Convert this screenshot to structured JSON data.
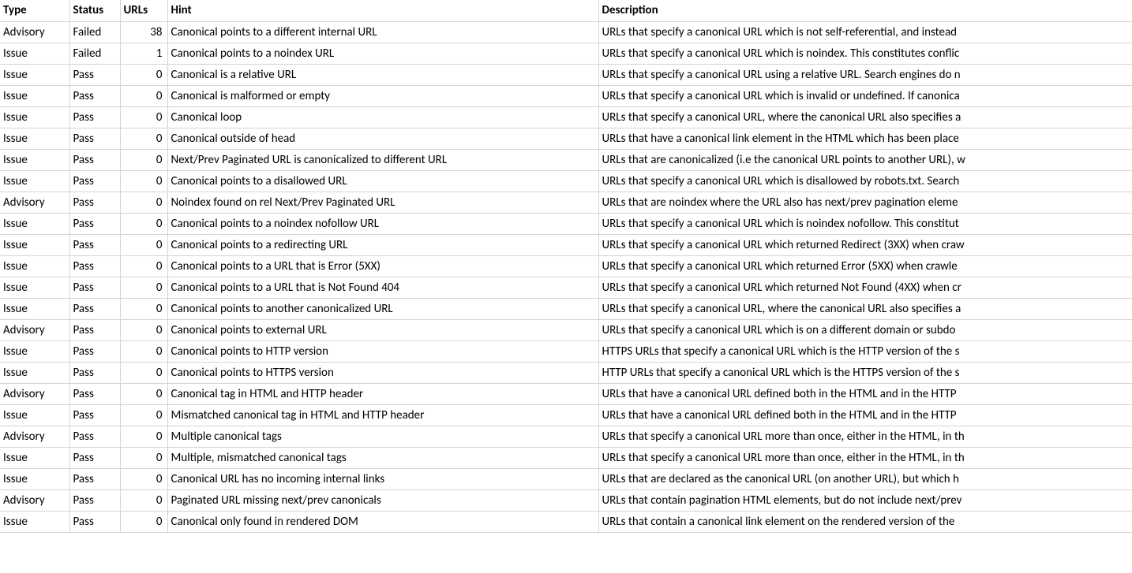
{
  "headers": {
    "type": "Type",
    "status": "Status",
    "urls": "URLs",
    "hint": "Hint",
    "description": "Description"
  },
  "rows": [
    {
      "type": "Advisory",
      "status": "Failed",
      "urls": 38,
      "hint": "Canonical points to a different internal URL",
      "description": "URLs that specify a canonical URL which is not self-referential, and instead"
    },
    {
      "type": "Issue",
      "status": "Failed",
      "urls": 1,
      "hint": "Canonical points to a noindex URL",
      "description": "URLs that specify a canonical URL which is noindex. This constitutes conflic"
    },
    {
      "type": "Issue",
      "status": "Pass",
      "urls": 0,
      "hint": "Canonical is a relative URL",
      "description": "URLs that specify a canonical URL using a relative URL. Search engines do n"
    },
    {
      "type": "Issue",
      "status": "Pass",
      "urls": 0,
      "hint": "Canonical is malformed or empty",
      "description": "URLs that specify a canonical URL which is invalid or undefined. If canonica"
    },
    {
      "type": "Issue",
      "status": "Pass",
      "urls": 0,
      "hint": "Canonical loop",
      "description": "URLs that specify a canonical URL, where the canonical URL also specifies a"
    },
    {
      "type": "Issue",
      "status": "Pass",
      "urls": 0,
      "hint": "Canonical outside of head",
      "description": "URLs that have a canonical link element in the HTML which has been place"
    },
    {
      "type": "Issue",
      "status": "Pass",
      "urls": 0,
      "hint": "Next/Prev Paginated URL is canonicalized to different URL",
      "description": "URLs that are canonicalized (i.e the canonical URL points to another URL), w"
    },
    {
      "type": "Issue",
      "status": "Pass",
      "urls": 0,
      "hint": "Canonical points to a disallowed URL",
      "description": "URLs that specify a canonical URL which is disallowed by robots.txt. Search"
    },
    {
      "type": "Advisory",
      "status": "Pass",
      "urls": 0,
      "hint": "Noindex found on rel Next/Prev Paginated URL",
      "description": "URLs that are noindex where the URL also has next/prev pagination eleme"
    },
    {
      "type": "Issue",
      "status": "Pass",
      "urls": 0,
      "hint": "Canonical points to a noindex nofollow URL",
      "description": "URLs that specify a canonical URL which is noindex nofollow. This constitut"
    },
    {
      "type": "Issue",
      "status": "Pass",
      "urls": 0,
      "hint": "Canonical points to a redirecting URL",
      "description": "URLs that specify a canonical URL which returned Redirect (3XX) when craw"
    },
    {
      "type": "Issue",
      "status": "Pass",
      "urls": 0,
      "hint": "Canonical points to a URL that is Error (5XX)",
      "description": "URLs that specify a canonical URL which returned Error (5XX) when crawle"
    },
    {
      "type": "Issue",
      "status": "Pass",
      "urls": 0,
      "hint": "Canonical points to a URL that is Not Found 404",
      "description": "URLs that specify a canonical URL which returned Not Found (4XX) when cr"
    },
    {
      "type": "Issue",
      "status": "Pass",
      "urls": 0,
      "hint": "Canonical points to another canonicalized URL",
      "description": "URLs that specify a canonical URL, where the canonical URL also specifies a"
    },
    {
      "type": "Advisory",
      "status": "Pass",
      "urls": 0,
      "hint": "Canonical points to external URL",
      "description": "URLs that specify a canonical URL which is on a different domain or subdo"
    },
    {
      "type": "Issue",
      "status": "Pass",
      "urls": 0,
      "hint": "Canonical points to HTTP version",
      "description": "HTTPS URLs that specify a canonical URL which is the HTTP version of the s"
    },
    {
      "type": "Issue",
      "status": "Pass",
      "urls": 0,
      "hint": "Canonical points to HTTPS version",
      "description": "HTTP URLs that specify a canonical URL which is the HTTPS version of the s"
    },
    {
      "type": "Advisory",
      "status": "Pass",
      "urls": 0,
      "hint": "Canonical tag in HTML and HTTP header",
      "description": "URLs that have a canonical URL defined both in the HTML and in the HTTP"
    },
    {
      "type": "Issue",
      "status": "Pass",
      "urls": 0,
      "hint": "Mismatched canonical tag in HTML and HTTP header",
      "description": "URLs that have a canonical URL defined both in the HTML and in the HTTP"
    },
    {
      "type": "Advisory",
      "status": "Pass",
      "urls": 0,
      "hint": "Multiple canonical tags",
      "description": "URLs that specify a canonical URL more than once, either in the HTML, in th"
    },
    {
      "type": "Issue",
      "status": "Pass",
      "urls": 0,
      "hint": "Multiple, mismatched canonical tags",
      "description": "URLs that specify a canonical URL more than once, either in the HTML, in th"
    },
    {
      "type": "Issue",
      "status": "Pass",
      "urls": 0,
      "hint": "Canonical URL has no incoming internal links",
      "description": "URLs that are declared as the canonical URL (on another URL), but which h"
    },
    {
      "type": "Advisory",
      "status": "Pass",
      "urls": 0,
      "hint": "Paginated URL missing next/prev canonicals",
      "description": "URLs that contain pagination HTML elements, but do not include next/prev"
    },
    {
      "type": "Issue",
      "status": "Pass",
      "urls": 0,
      "hint": "Canonical only found in rendered DOM",
      "description": "URLs that contain a canonical link element on the rendered version of the"
    }
  ]
}
